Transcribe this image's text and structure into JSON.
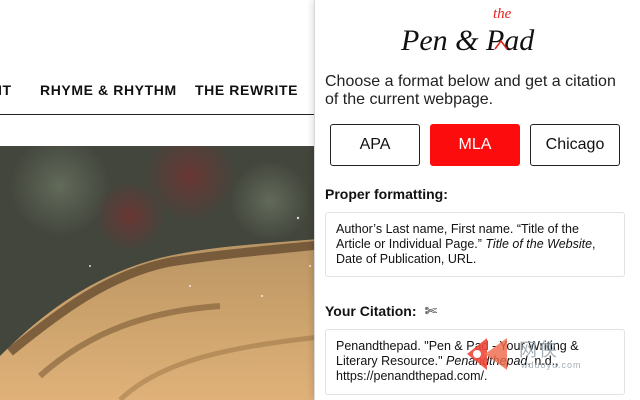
{
  "site": {
    "nav": {
      "partial_item": "IT",
      "rhyme": "RHYME & RHYTHM",
      "rewrite": "THE REWRITE"
    }
  },
  "popup": {
    "logo": {
      "main": "Pen & Pad",
      "the": "the"
    },
    "intro": "Choose a format below and get a citation of the current webpage.",
    "formats": {
      "apa": "APA",
      "mla": "MLA",
      "chicago": "Chicago",
      "selected": "MLA"
    },
    "formatting": {
      "title": "Proper formatting:",
      "part1": "Author’s Last name, First name. “Title of the Article or Individual Page.” ",
      "part2_italic": "Title of the Website",
      "part3": ", Date of Publication, URL."
    },
    "citation": {
      "title": "Your Citation:",
      "icon": "scissors-icon",
      "part1": "Penandthepad. \"Pen & Pad - Your Writing & Literary Resource.\" ",
      "part2_italic": "Penandthepad",
      "part3": ", n.d., https://penandthepad.com/."
    }
  },
  "watermark": {
    "text": "网侠",
    "sub": "wduoyu.com"
  },
  "colors": {
    "accent_red": "#fc0c0c",
    "logo_red": "#e52420"
  }
}
